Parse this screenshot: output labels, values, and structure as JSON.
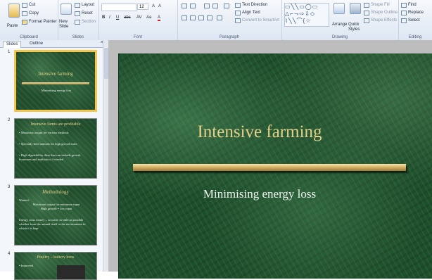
{
  "ribbon": {
    "clipboard": {
      "paste": "Paste",
      "cut": "Cut",
      "copy": "Copy",
      "format_painter": "Format Painter",
      "label": "Clipboard"
    },
    "slides": {
      "new_slide": "New Slide",
      "layout": "Layout",
      "reset": "Reset",
      "section": "Section",
      "label": "Slides"
    },
    "font": {
      "size": "12",
      "bold": "B",
      "italic": "I",
      "underline": "U",
      "strike": "abc",
      "spacing": "AV",
      "case": "Aa",
      "color": "A",
      "label": "Font"
    },
    "paragraph": {
      "text_direction": "Text Direction",
      "align_text": "Align Text",
      "smartart": "Convert to SmartArt",
      "label": "Paragraph"
    },
    "drawing": {
      "arrange": "Arrange",
      "quick_styles": "Quick Styles",
      "shape_fill": "Shape Fill",
      "shape_outline": "Shape Outline",
      "shape_effects": "Shape Effects",
      "label": "Drawing"
    },
    "editing": {
      "find": "Find",
      "replace": "Replace",
      "select": "Select",
      "label": "Editing"
    }
  },
  "panel": {
    "tabs": [
      "Slides",
      "Outline"
    ],
    "slides": [
      {
        "number": "1",
        "title": "Intensive farming",
        "body": [
          "Minimising energy loss"
        ]
      },
      {
        "number": "2",
        "title": "Intensive farms are profitable",
        "body": [
          "• Maximise output for various methods",
          "• Specially bred animals for high growth rates",
          "• High digestibility diets that can include growth hormones and antibiotics if needed"
        ]
      },
      {
        "number": "3",
        "title": "Methodology",
        "body": [
          "Wanted:",
          "Maximum output for minimum input",
          "High growth = low input",
          "Energy costs money – so waste as little as possible whether from the animal itself or the environment in which it is kept"
        ]
      },
      {
        "number": "4",
        "title": "Poultry – battery hens",
        "body": [
          "• Improved"
        ]
      }
    ]
  },
  "main_slide": {
    "title": "Intensive farming",
    "subtitle": "Minimising energy loss"
  }
}
